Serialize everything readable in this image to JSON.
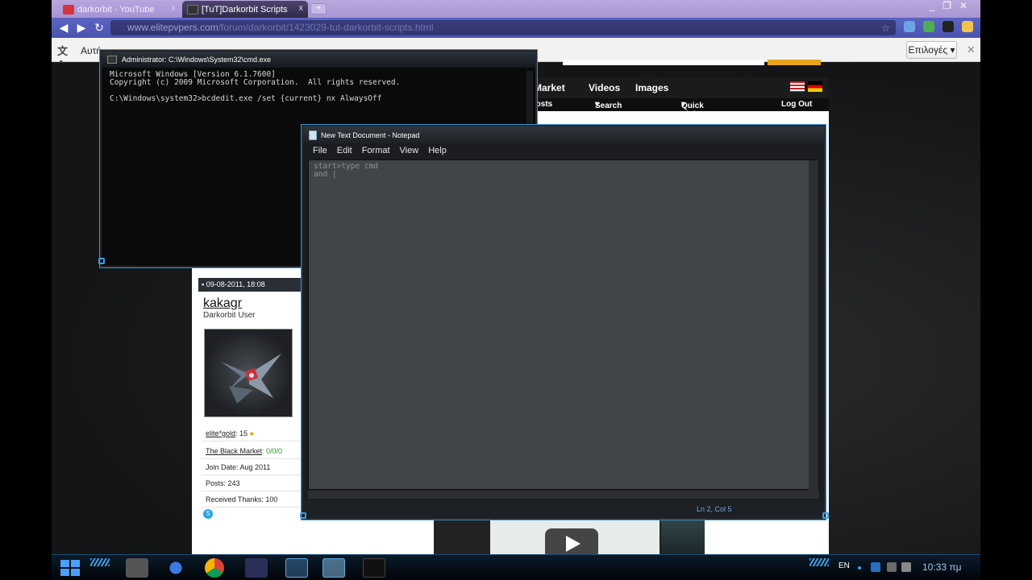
{
  "browser": {
    "tabs": [
      {
        "label": "darkorbit - YouTube",
        "close": "x"
      },
      {
        "label": "[TuT]Darkorbit Scripts",
        "close": "x"
      }
    ],
    "window_controls": [
      "_",
      "❐",
      "✕"
    ],
    "url": {
      "host": "www.elitepvpers.com",
      "path": "/forum/darkorbit/1423029-tut-darkorbit-scripts.html"
    },
    "nav": {
      "back": "◀",
      "forward": "▶",
      "reload": "↻"
    }
  },
  "translate_bar": {
    "label": "Αυτή",
    "options_button": "Επιλογές",
    "close": "✕"
  },
  "site": {
    "nav_items": [
      "Market",
      "Videos",
      "Images"
    ],
    "subnav_items": [
      "Posts",
      "Search",
      "Quick Links",
      "Log Out"
    ]
  },
  "post": {
    "date": "09-08-2011, 18:08",
    "username": "kakagr",
    "user_title": "Darkorbit User",
    "elite_gold_label": "elite*gold",
    "elite_gold_value": ": 15",
    "black_market_label": "The Black Market",
    "black_market_value": ": 0/0/0",
    "join_date": "Join Date: Aug 2011",
    "posts": "Posts: 243",
    "thanks": "Received Thanks: 100"
  },
  "cmd": {
    "title": "Administrator: C:\\Windows\\System32\\cmd.exe",
    "lines": [
      "Microsoft Windows [Version 6.1.7600]",
      "Copyright (c) 2009 Microsoft Corporation.  All rights reserved.",
      "",
      "C:\\Windows\\system32>bcdedit.exe /set {current} nx AlwaysOff"
    ]
  },
  "notepad": {
    "title": "New Text Document - Notepad",
    "menu": [
      "File",
      "Edit",
      "Format",
      "View",
      "Help"
    ],
    "content": "start>type cmd\nand |",
    "status": "Ln 2, Col 5"
  },
  "taskbar": {
    "language": "EN",
    "clock": "10:33 πμ"
  },
  "colors": {
    "accent_blue": "#3a8fcf",
    "chrome_theme": "#4a53b0",
    "tab_strip": "#a895d2"
  }
}
